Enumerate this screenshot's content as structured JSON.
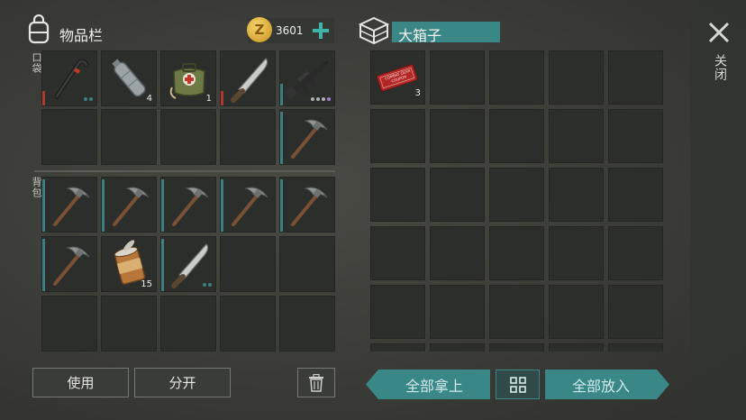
{
  "inventory": {
    "title": "物品栏",
    "currency": "3601",
    "currency_coin_letter": "Z",
    "pocket_label": "口袋",
    "backpack_label": "背包",
    "pocket_slots": [
      {
        "item": "crowbar-icon",
        "qty": "",
        "bar": "red",
        "dots": [
          "#3d7f80",
          "#3d7f80"
        ]
      },
      {
        "item": "water-bottle-icon",
        "qty": "4",
        "bar": "",
        "dots": []
      },
      {
        "item": "medkit-icon",
        "qty": "1",
        "bar": "",
        "dots": []
      },
      {
        "item": "machete-icon",
        "qty": "",
        "bar": "red",
        "dots": []
      },
      {
        "item": "assault-rifle-icon",
        "qty": "",
        "bar": "teal",
        "dots": [
          "#b0b0b0",
          "#b0b0b0",
          "#b0b0b0",
          "#9a7fd0"
        ]
      },
      {
        "item": "",
        "qty": "",
        "bar": "",
        "dots": []
      },
      {
        "item": "",
        "qty": "",
        "bar": "",
        "dots": []
      },
      {
        "item": "",
        "qty": "",
        "bar": "",
        "dots": []
      },
      {
        "item": "",
        "qty": "",
        "bar": "",
        "dots": []
      },
      {
        "item": "pickaxe-icon",
        "qty": "",
        "bar": "teal",
        "dots": []
      }
    ],
    "backpack_slots": [
      {
        "item": "pickaxe-icon",
        "qty": "",
        "bar": "teal",
        "dots": []
      },
      {
        "item": "pickaxe-icon",
        "qty": "",
        "bar": "teal",
        "dots": []
      },
      {
        "item": "pickaxe-icon",
        "qty": "",
        "bar": "teal",
        "dots": []
      },
      {
        "item": "pickaxe-icon",
        "qty": "",
        "bar": "teal",
        "dots": []
      },
      {
        "item": "pickaxe-icon",
        "qty": "",
        "bar": "teal",
        "dots": []
      },
      {
        "item": "pickaxe-icon",
        "qty": "",
        "bar": "teal",
        "dots": []
      },
      {
        "item": "canned-food-icon",
        "qty": "15",
        "bar": "",
        "dots": []
      },
      {
        "item": "machete-icon",
        "qty": "",
        "bar": "teal",
        "dots": [
          "#3d7f80",
          "#3d7f80"
        ]
      },
      {
        "item": "",
        "qty": "",
        "bar": "",
        "dots": []
      },
      {
        "item": "",
        "qty": "",
        "bar": "",
        "dots": []
      },
      {
        "item": "",
        "qty": "",
        "bar": "",
        "dots": []
      },
      {
        "item": "",
        "qty": "",
        "bar": "",
        "dots": []
      },
      {
        "item": "",
        "qty": "",
        "bar": "",
        "dots": []
      },
      {
        "item": "",
        "qty": "",
        "bar": "",
        "dots": []
      },
      {
        "item": "",
        "qty": "",
        "bar": "",
        "dots": []
      }
    ],
    "use_label": "使用",
    "split_label": "分开"
  },
  "container": {
    "title": "大箱子",
    "coupon_text": "COMBAT GEAR COUPON",
    "coupon_qty": "3",
    "take_all_label": "全部拿上",
    "put_all_label": "全部放入"
  },
  "close_label": "关闭",
  "colors": {
    "accent": "#3a8788",
    "durability_red": "#b0392f",
    "durability_teal": "#3d7f80"
  }
}
